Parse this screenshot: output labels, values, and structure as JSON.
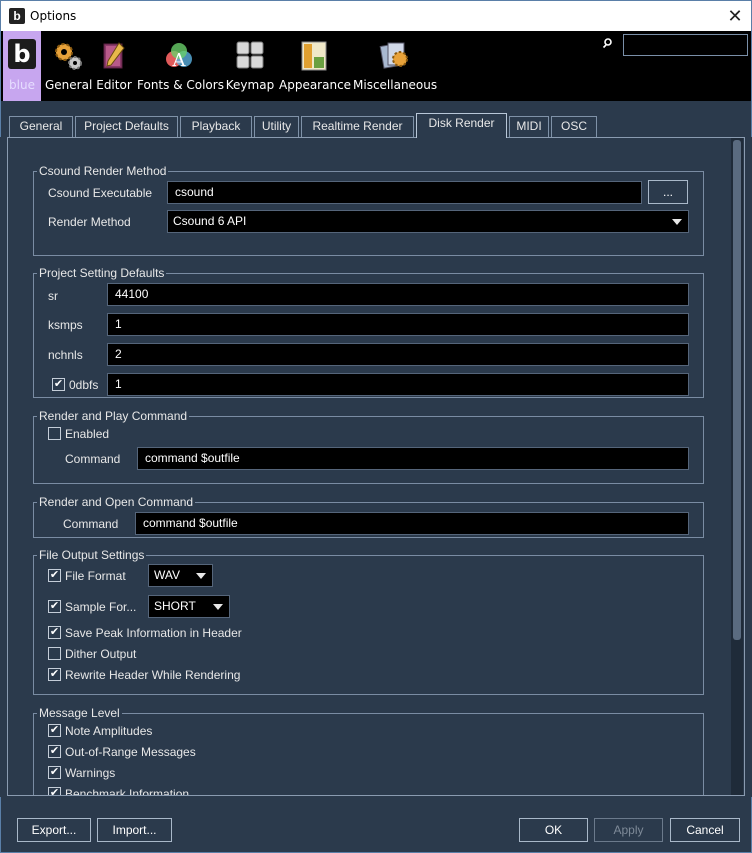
{
  "window": {
    "title": "Options",
    "app_icon": "b",
    "close_glyph": "✕"
  },
  "toolbar": {
    "items": [
      {
        "label": "blue",
        "icon": "blue-logo-icon"
      },
      {
        "label": "General",
        "icon": "gears-icon"
      },
      {
        "label": "Editor",
        "icon": "pencil-book-icon"
      },
      {
        "label": "Fonts & Colors",
        "icon": "fonts-colors-icon"
      },
      {
        "label": "Keymap",
        "icon": "keyboard-keys-icon"
      },
      {
        "label": "Appearance",
        "icon": "appearance-icon"
      },
      {
        "label": "Miscellaneous",
        "icon": "cards-gear-icon"
      }
    ],
    "blue_glyph": "b",
    "search_value": ""
  },
  "tabs": [
    "General",
    "Project Defaults",
    "Playback",
    "Utility",
    "Realtime Render",
    "Disk Render",
    "MIDI",
    "OSC"
  ],
  "active_tab": "Disk Render",
  "csound_render_method": {
    "legend": "Csound Render Method",
    "executable_label": "Csound Executable",
    "executable_value": "csound",
    "browse_label": "...",
    "render_method_label": "Render Method",
    "render_method_value": "Csound 6 API"
  },
  "project_setting_defaults": {
    "legend": "Project Setting Defaults",
    "sr_label": "sr",
    "sr_value": "44100",
    "ksmps_label": "ksmps",
    "ksmps_value": "1",
    "nchnls_label": "nchnls",
    "nchnls_value": "2",
    "zerodbfs_label": "0dbfs",
    "zerodbfs_value": "1",
    "zerodbfs_checked": true
  },
  "render_and_play": {
    "legend": "Render and Play Command",
    "enabled_label": "Enabled",
    "enabled_checked": false,
    "command_label": "Command",
    "command_value": "command $outfile"
  },
  "render_and_open": {
    "legend": "Render and Open Command",
    "command_label": "Command",
    "command_value": "command $outfile"
  },
  "file_output": {
    "legend": "File Output Settings",
    "file_format_label": "File Format",
    "file_format_value": "WAV",
    "file_format_checked": true,
    "sample_format_label": "Sample For...",
    "sample_format_value": "SHORT",
    "sample_format_checked": true,
    "save_peak_label": "Save Peak Information in Header",
    "save_peak_checked": true,
    "dither_label": "Dither Output",
    "dither_checked": false,
    "rewrite_label": "Rewrite Header While Rendering",
    "rewrite_checked": true
  },
  "message_level": {
    "legend": "Message Level",
    "items": [
      {
        "label": "Note Amplitudes",
        "checked": true
      },
      {
        "label": "Out-of-Range Messages",
        "checked": true
      },
      {
        "label": "Warnings",
        "checked": true
      },
      {
        "label": "Benchmark Information",
        "checked": true
      }
    ]
  },
  "buttons": {
    "export": "Export...",
    "import": "Import...",
    "ok": "OK",
    "apply": "Apply",
    "cancel": "Cancel"
  },
  "colors": {
    "background": "#2b3a4c",
    "field": "#000000",
    "toolbar": "#000000",
    "blue_highlight": "#c7a6ef"
  }
}
